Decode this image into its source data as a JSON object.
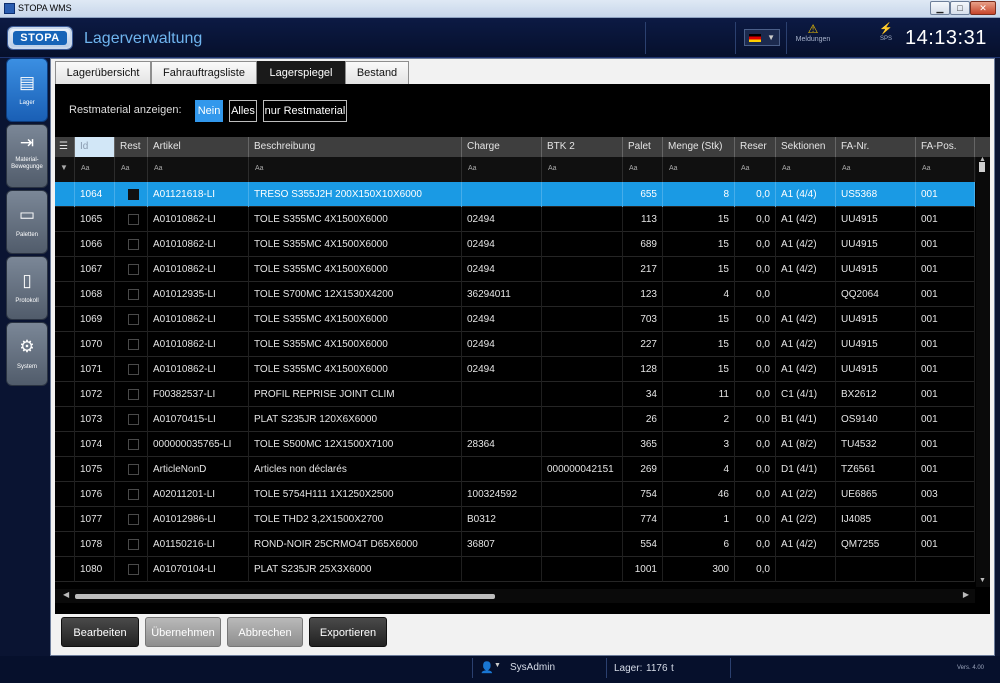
{
  "window": {
    "title": "STOPA WMS",
    "minimize": "▁",
    "maximize": "□",
    "close": "✕"
  },
  "header": {
    "logo": "STOPA",
    "title": "Lagerverwaltung",
    "messages_label": "Meldungen",
    "sps_label": "SPS",
    "clock": "14:13:31",
    "language": "de"
  },
  "sidebar": [
    {
      "label": "Lager",
      "icon": "storage-icon",
      "active": true
    },
    {
      "label": "Material-\nBewegunge",
      "icon": "material-movement-icon",
      "active": false
    },
    {
      "label": "Paletten",
      "icon": "pallet-icon",
      "active": false
    },
    {
      "label": "Protokoll",
      "icon": "document-icon",
      "active": false
    },
    {
      "label": "System",
      "icon": "gear-icon",
      "active": false
    }
  ],
  "tabs": [
    {
      "label": "Lagerübersicht",
      "active": false
    },
    {
      "label": "Fahrauftragsliste",
      "active": false
    },
    {
      "label": "Lagerspiegel",
      "active": true
    },
    {
      "label": "Bestand",
      "active": false
    }
  ],
  "filter": {
    "label": "Restmaterial anzeigen:",
    "options": [
      {
        "label": "Nein",
        "active": true
      },
      {
        "label": "Alles",
        "active": false
      },
      {
        "label": "nur Restmaterial",
        "active": false
      }
    ]
  },
  "grid": {
    "columns": [
      "Id",
      "Rest",
      "Artikel",
      "Beschreibung",
      "Charge",
      "BTK 2",
      "Palet",
      "Menge (Stk)",
      "Reser",
      "Sektionen",
      "FA-Nr.",
      "FA-Pos."
    ],
    "filter_placeholder": "Aa",
    "rows": [
      {
        "id": "1064",
        "rest": true,
        "artikel": "A01121618-LI",
        "beschreibung": "TRESO S355J2H 200X150X10X6000",
        "charge": "",
        "btk2": "",
        "palet": "655",
        "menge": "8",
        "reser": "0,0",
        "sektionen": "A1 (4/4)",
        "fa_nr": "US5368",
        "fa_pos": "001",
        "selected": true
      },
      {
        "id": "1065",
        "rest": false,
        "artikel": "A01010862-LI",
        "beschreibung": "TOLE S355MC 4X1500X6000",
        "charge": "02494",
        "btk2": "",
        "palet": "113",
        "menge": "15",
        "reser": "0,0",
        "sektionen": "A1 (4/2)",
        "fa_nr": "UU4915",
        "fa_pos": "001"
      },
      {
        "id": "1066",
        "rest": false,
        "artikel": "A01010862-LI",
        "beschreibung": "TOLE S355MC 4X1500X6000",
        "charge": "02494",
        "btk2": "",
        "palet": "689",
        "menge": "15",
        "reser": "0,0",
        "sektionen": "A1 (4/2)",
        "fa_nr": "UU4915",
        "fa_pos": "001"
      },
      {
        "id": "1067",
        "rest": false,
        "artikel": "A01010862-LI",
        "beschreibung": "TOLE S355MC 4X1500X6000",
        "charge": "02494",
        "btk2": "",
        "palet": "217",
        "menge": "15",
        "reser": "0,0",
        "sektionen": "A1 (4/2)",
        "fa_nr": "UU4915",
        "fa_pos": "001"
      },
      {
        "id": "1068",
        "rest": false,
        "artikel": "A01012935-LI",
        "beschreibung": "TOLE S700MC 12X1530X4200",
        "charge": "36294011",
        "btk2": "",
        "palet": "123",
        "menge": "4",
        "reser": "0,0",
        "sektionen": "",
        "fa_nr": "QQ2064",
        "fa_pos": "001"
      },
      {
        "id": "1069",
        "rest": false,
        "artikel": "A01010862-LI",
        "beschreibung": "TOLE S355MC 4X1500X6000",
        "charge": "02494",
        "btk2": "",
        "palet": "703",
        "menge": "15",
        "reser": "0,0",
        "sektionen": "A1 (4/2)",
        "fa_nr": "UU4915",
        "fa_pos": "001"
      },
      {
        "id": "1070",
        "rest": false,
        "artikel": "A01010862-LI",
        "beschreibung": "TOLE S355MC 4X1500X6000",
        "charge": "02494",
        "btk2": "",
        "palet": "227",
        "menge": "15",
        "reser": "0,0",
        "sektionen": "A1 (4/2)",
        "fa_nr": "UU4915",
        "fa_pos": "001"
      },
      {
        "id": "1071",
        "rest": false,
        "artikel": "A01010862-LI",
        "beschreibung": "TOLE S355MC 4X1500X6000",
        "charge": "02494",
        "btk2": "",
        "palet": "128",
        "menge": "15",
        "reser": "0,0",
        "sektionen": "A1 (4/2)",
        "fa_nr": "UU4915",
        "fa_pos": "001"
      },
      {
        "id": "1072",
        "rest": false,
        "artikel": "F00382537-LI",
        "beschreibung": "PROFIL REPRISE JOINT CLIM",
        "charge": "",
        "btk2": "",
        "palet": "34",
        "menge": "11",
        "reser": "0,0",
        "sektionen": "C1 (4/1)",
        "fa_nr": "BX2612",
        "fa_pos": "001"
      },
      {
        "id": "1073",
        "rest": false,
        "artikel": "A01070415-LI",
        "beschreibung": "PLAT S235JR 120X6X6000",
        "charge": "",
        "btk2": "",
        "palet": "26",
        "menge": "2",
        "reser": "0,0",
        "sektionen": "B1 (4/1)",
        "fa_nr": "OS9140",
        "fa_pos": "001"
      },
      {
        "id": "1074",
        "rest": false,
        "artikel": "000000035765-LI",
        "beschreibung": "TOLE S500MC 12X1500X7100",
        "charge": "28364",
        "btk2": "",
        "palet": "365",
        "menge": "3",
        "reser": "0,0",
        "sektionen": "A1 (8/2)",
        "fa_nr": "TU4532",
        "fa_pos": "001"
      },
      {
        "id": "1075",
        "rest": false,
        "artikel": "ArticleNonD",
        "beschreibung": "Articles non déclarés",
        "charge": "",
        "btk2": "000000042151",
        "palet": "269",
        "menge": "4",
        "reser": "0,0",
        "sektionen": "D1 (4/1)",
        "fa_nr": "TZ6561",
        "fa_pos": "001"
      },
      {
        "id": "1076",
        "rest": false,
        "artikel": "A02011201-LI",
        "beschreibung": "TOLE 5754H111 1X1250X2500",
        "charge": "100324592",
        "btk2": "",
        "palet": "754",
        "menge": "46",
        "reser": "0,0",
        "sektionen": "A1 (2/2)",
        "fa_nr": "UE6865",
        "fa_pos": "003"
      },
      {
        "id": "1077",
        "rest": false,
        "artikel": "A01012986-LI",
        "beschreibung": "TOLE THD2 3,2X1500X2700",
        "charge": "B0312",
        "btk2": "",
        "palet": "774",
        "menge": "1",
        "reser": "0,0",
        "sektionen": "A1 (2/2)",
        "fa_nr": "IJ4085",
        "fa_pos": "001"
      },
      {
        "id": "1078",
        "rest": false,
        "artikel": "A01150216-LI",
        "beschreibung": "ROND-NOIR 25CRMO4T D65X6000",
        "charge": "36807",
        "btk2": "",
        "palet": "554",
        "menge": "6",
        "reser": "0,0",
        "sektionen": "A1 (4/2)",
        "fa_nr": "QM7255",
        "fa_pos": "001"
      },
      {
        "id": "1080",
        "rest": false,
        "artikel": "A01070104-LI",
        "beschreibung": "PLAT S235JR 25X3X6000",
        "charge": "",
        "btk2": "",
        "palet": "1001",
        "menge": "300",
        "reser": "0,0",
        "sektionen": "",
        "fa_nr": "",
        "fa_pos": ""
      }
    ]
  },
  "actions": [
    {
      "label": "Bearbeiten",
      "style": "dark"
    },
    {
      "label": "Übernehmen",
      "style": "light"
    },
    {
      "label": "Abbrechen",
      "style": "light"
    },
    {
      "label": "Exportieren",
      "style": "dark"
    }
  ],
  "statusbar": {
    "user": "SysAdmin",
    "lager_label": "Lager:",
    "lager_value": "1176",
    "lager_unit": "t",
    "version": "Vers. 4.00"
  },
  "colors": {
    "accent": "#3298ec",
    "selected_row": "#1a9ae4",
    "header_bg": "#0c1a44"
  }
}
